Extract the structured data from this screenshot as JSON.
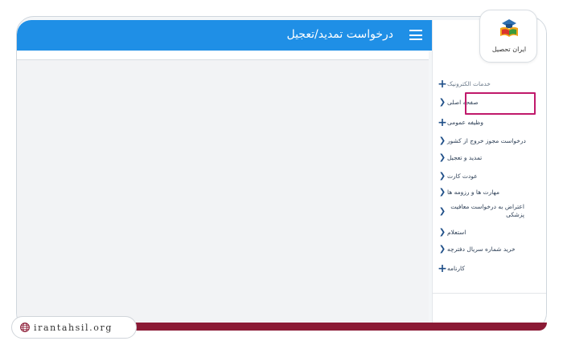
{
  "header": {
    "title": "درخواست تمدید/تعجیل",
    "menu_icon": "hamburger-menu-icon",
    "bg_color": "#1f8fe6"
  },
  "sidebar": {
    "items": [
      {
        "label": "خدمات الکترونیک",
        "icon": "plus-icon"
      },
      {
        "label": "صفحه اصلی",
        "icon": "chevron-left-icon"
      },
      {
        "label": "وظیفه عمومی",
        "icon": "plus-icon",
        "highlighted": true
      },
      {
        "label": "درخواست مجوز خروج از کشور",
        "icon": "chevron-left-icon"
      },
      {
        "label": "تمدید و تعجیل",
        "icon": "chevron-left-icon"
      },
      {
        "label": "عودت کارت",
        "icon": "chevron-left-icon"
      },
      {
        "label": "مهارت ها و رزومه ها",
        "icon": "chevron-left-icon"
      },
      {
        "label": "اعتراض به درخواست معافیت پزشکی",
        "icon": "chevron-left-icon"
      },
      {
        "label": "استعلام",
        "icon": "chevron-left-icon"
      },
      {
        "label": "خرید شماره سریال دفترچه",
        "icon": "chevron-left-icon"
      },
      {
        "label": "کارنامه",
        "icon": "plus-icon"
      }
    ]
  },
  "branding": {
    "logo_text": "ایران تحصیل",
    "site_url": "irantahsil.org",
    "accent_color": "#8b1a35",
    "highlight_color": "#c0196b"
  }
}
